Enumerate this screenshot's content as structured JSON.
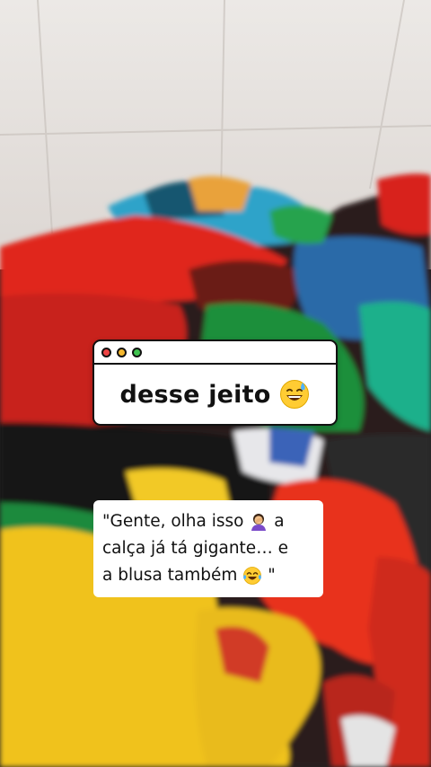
{
  "window_card": {
    "title": "desse jeito",
    "emoji": "grinning-sweat-emoji",
    "dot_colors": [
      "#ee4444",
      "#f5b82e",
      "#3fc34f"
    ]
  },
  "caption": {
    "line1": "\"Gente, olha isso",
    "line1_end": "a",
    "line2": "calça já tá gigante… e",
    "line3": "a blusa também",
    "line3_end": "\""
  },
  "colors": {
    "tile_wall": "#e9e6e2",
    "card_bg": "#ffffff",
    "card_border": "#111111"
  }
}
